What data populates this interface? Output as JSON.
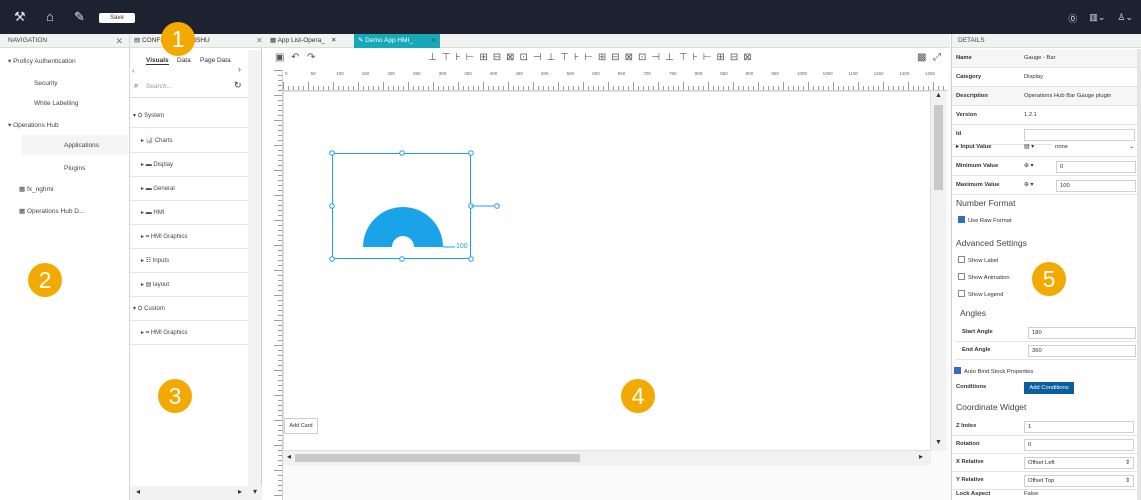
{
  "topbar": {
    "save_label": "Save",
    "icons": [
      "tools-icon",
      "home-icon",
      "brush-icon",
      "help-icon",
      "layout-icon",
      "user-icon"
    ]
  },
  "navigation": {
    "title": "NAVIGATION",
    "items": [
      {
        "label": "Proficy Authentication"
      },
      {
        "label": "Security"
      },
      {
        "label": "White Labelling"
      },
      {
        "label": "Operations Hub"
      },
      {
        "label": "Applications"
      },
      {
        "label": "Plugins"
      },
      {
        "label": "fx_nghmi"
      },
      {
        "label": "Operations Hub D..."
      }
    ]
  },
  "palette": {
    "tab_title": "CONFIGURATIONSHU",
    "tabs": [
      "Visuals",
      "Data",
      "Page Data"
    ],
    "search_placeholder": "Search...",
    "groups": [
      {
        "label": "System"
      },
      {
        "label": "Charts"
      },
      {
        "label": "Display"
      },
      {
        "label": "General"
      },
      {
        "label": "HMI"
      },
      {
        "label": "HMI Graphics"
      },
      {
        "label": "Inputs"
      },
      {
        "label": "layout"
      },
      {
        "label": "Custom"
      },
      {
        "label": "HMI Graphics"
      }
    ]
  },
  "editor": {
    "tabs": [
      {
        "label": "App List-Opera_"
      },
      {
        "label": "Demo App HMI_"
      }
    ],
    "gauge_max_label": "100",
    "add_card_label": "Add Card",
    "ruler_ticks": [
      "0",
      "50",
      "100",
      "150",
      "200",
      "250",
      "300",
      "350",
      "400",
      "450",
      "500",
      "550",
      "600",
      "650",
      "700",
      "750",
      "800",
      "850",
      "900",
      "950",
      "1000",
      "1050",
      "1100",
      "1150",
      "1200",
      "1250"
    ]
  },
  "details": {
    "title": "DETAILS",
    "rows": [
      {
        "label": "Name",
        "value": "Gauge - Bar"
      },
      {
        "label": "Category",
        "value": "Display"
      },
      {
        "label": "Description",
        "value": "Operations Hub Bar Gauge plugin"
      },
      {
        "label": "Version",
        "value": "1.2.1"
      },
      {
        "label": "Id",
        "value": ""
      },
      {
        "label": "Input Value",
        "value": "none"
      },
      {
        "label": "Minimum Value",
        "value": "0"
      },
      {
        "label": "Maximum Value",
        "value": "100"
      }
    ],
    "number_format_title": "Number Format",
    "use_raw_format": "Use Raw Format",
    "advanced_title": "Advanced Settings",
    "show_label": "Show Label",
    "show_animation": "Show Animation",
    "show_legend": "Show Legend",
    "angles_title": "Angles",
    "start_angle_label": "Start Angle",
    "start_angle": "180",
    "end_angle_label": "End Angle",
    "end_angle": "360",
    "auto_bind": "Auto Bind Stock Properties",
    "conditions_label": "Conditions",
    "add_conditions": "Add Conditions",
    "coord_title": "Coordinate Widget",
    "zindex_label": "Z Index",
    "zindex": "1",
    "rotation_label": "Rotation",
    "rotation": "0",
    "xrel_label": "X Relative",
    "xrel": "Offset Left",
    "yrel_label": "Y Relative",
    "yrel": "Offset Top",
    "lock_label": "Lock Aspect",
    "lock": "False"
  },
  "callouts": [
    "1",
    "2",
    "3",
    "4",
    "5"
  ],
  "colors": {
    "accent": "#1aa3e8",
    "topbar": "#1c2230",
    "badge": "#f2a900",
    "tab_active": "#17a9b8"
  }
}
